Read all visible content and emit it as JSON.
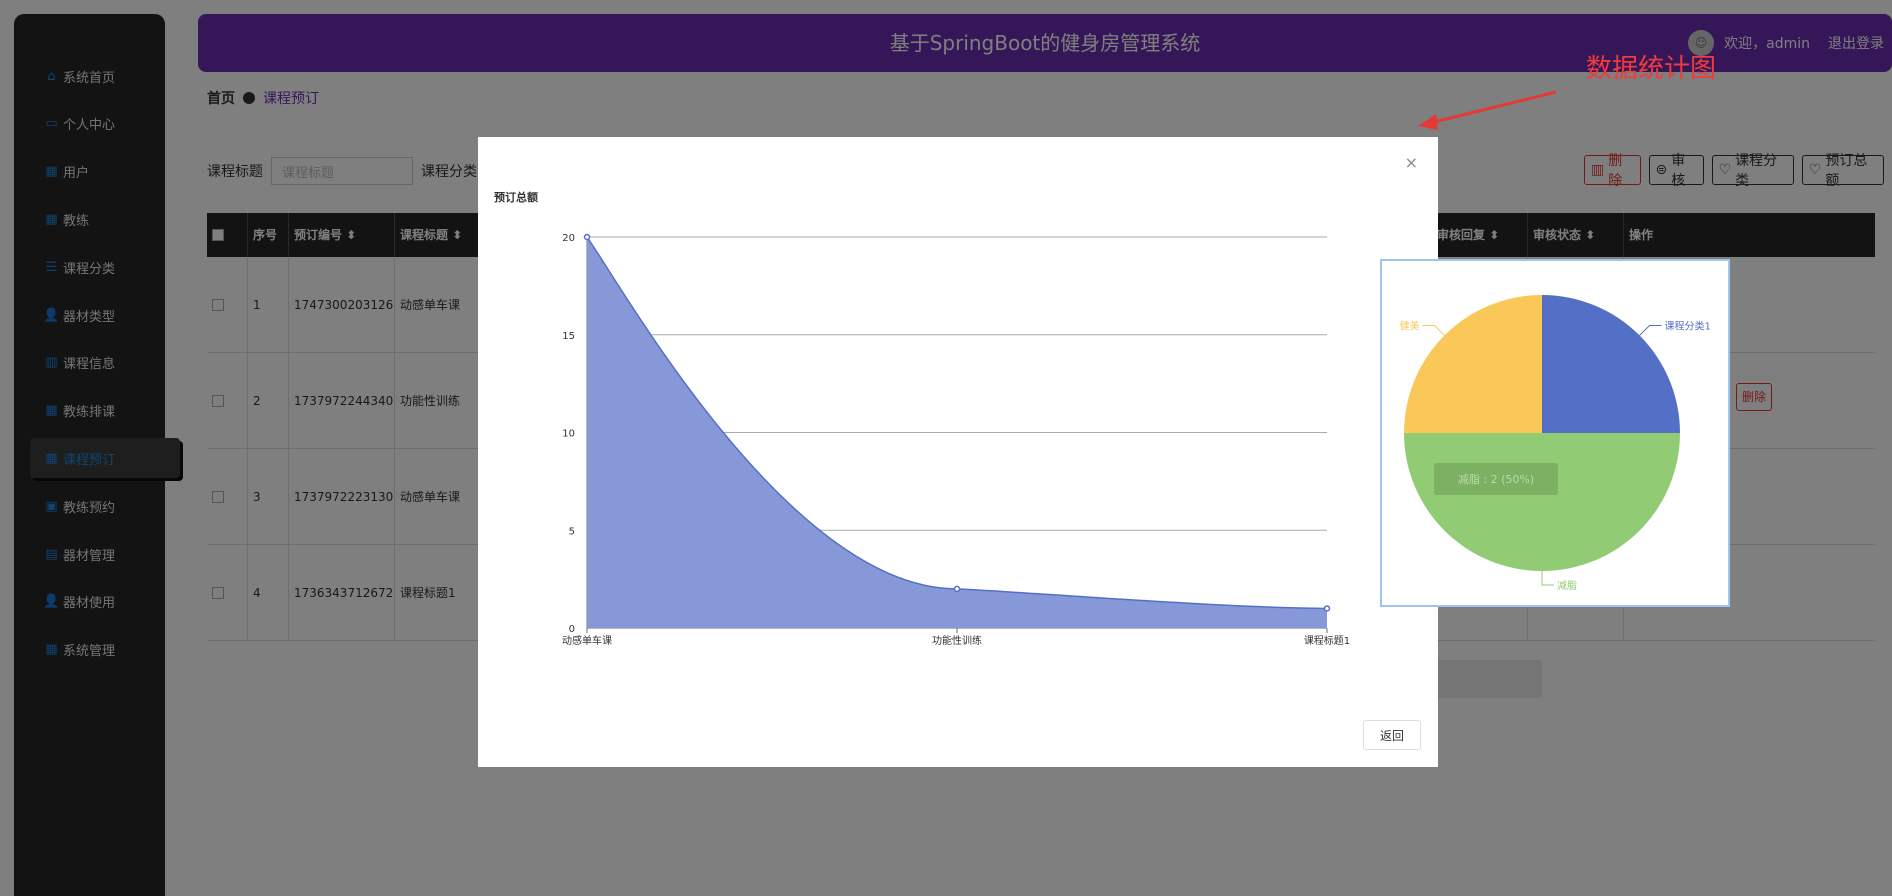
{
  "sidebar": {
    "items": [
      {
        "label": "系统首页",
        "icon": "home-icon"
      },
      {
        "label": "个人中心",
        "icon": "card-icon"
      },
      {
        "label": "用户",
        "icon": "grid-icon"
      },
      {
        "label": "教练",
        "icon": "grid-icon"
      },
      {
        "label": "课程分类",
        "icon": "list-icon"
      },
      {
        "label": "器材类型",
        "icon": "person-icon"
      },
      {
        "label": "课程信息",
        "icon": "bar-icon"
      },
      {
        "label": "教练排课",
        "icon": "grid-icon"
      },
      {
        "label": "课程预订",
        "icon": "grid-icon"
      },
      {
        "label": "教练预约",
        "icon": "briefcase-icon"
      },
      {
        "label": "器材管理",
        "icon": "clipboard-icon"
      },
      {
        "label": "器材使用",
        "icon": "person-icon"
      },
      {
        "label": "系统管理",
        "icon": "apps-icon"
      }
    ],
    "active_index": 8
  },
  "header": {
    "title": "基于SpringBoot的健身房管理系统",
    "welcome": "欢迎，admin",
    "logout": "退出登录"
  },
  "breadcrumb": {
    "home": "首页",
    "current": "课程预订"
  },
  "search": {
    "label1": "课程标题",
    "placeholder1": "课程标题",
    "label2": "课程分类"
  },
  "toolbar": {
    "delete": "删除",
    "audit": "审核",
    "category": "课程分类",
    "total": "预订总额"
  },
  "table": {
    "headers": [
      "序号",
      "预订编号",
      "课程标题",
      "审核回复",
      "审核状态",
      "操作"
    ],
    "rows": [
      {
        "no": "1",
        "code": "1747300203126",
        "title": "动感单车课"
      },
      {
        "no": "2",
        "code": "1737972244340",
        "title": "功能性训练"
      },
      {
        "no": "3",
        "code": "1737972223130",
        "title": "动感单车课"
      },
      {
        "no": "4",
        "code": "1736343712672",
        "title": "课程标题1"
      }
    ],
    "row_delete": "删除"
  },
  "modal": {
    "close": "×",
    "back": "返回"
  },
  "chart_data": [
    {
      "type": "area",
      "title": "预订总额",
      "categories": [
        "动感单车课",
        "功能性训练",
        "课程标题1"
      ],
      "values": [
        20,
        2,
        1
      ],
      "ylim": [
        0,
        20
      ],
      "yticks": [
        0,
        5,
        10,
        15,
        20
      ],
      "grid": true,
      "color": "#8698d8",
      "line_color": "#5470c6",
      "smooth": true
    },
    {
      "type": "pie",
      "slices": [
        {
          "name": "课程分类1",
          "value": 1,
          "color": "#5470c6"
        },
        {
          "name": "减脂",
          "value": 2,
          "color": "#91cc75"
        },
        {
          "name": "健美",
          "value": 1,
          "color": "#fac858"
        }
      ],
      "tooltip": "减脂 : 2 (50%)"
    }
  ],
  "annotation": {
    "text": "数据统计图",
    "color": "#ef3b3b"
  }
}
